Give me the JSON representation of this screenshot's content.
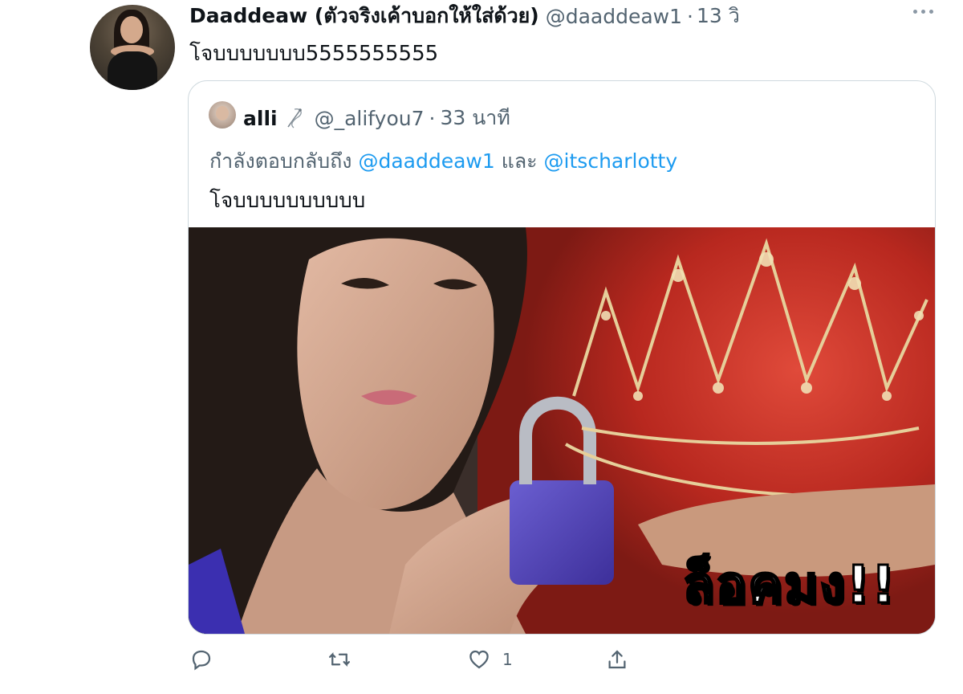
{
  "author": {
    "display_name": "Daaddeaw (ตัวจริงเค้าบอกให้ใส่ด้วย)",
    "handle": "@daaddeaw1",
    "separator": "·",
    "time": "13 วิ"
  },
  "tweet_text": "โจบบบบบบบ5555555555",
  "quoted": {
    "display_name": "alli",
    "handle": "@_alifyou7",
    "separator": "·",
    "time": "33 นาที",
    "reply_prefix": "กำลังตอบกลับถึง",
    "mention_1": "@daaddeaw1",
    "reply_and": "และ",
    "mention_2": "@itscharlotty",
    "text": "โจบบบบบบบบบบ",
    "image_caption": "ล็อคมง!!"
  },
  "actions": {
    "reply_icon": "reply-icon",
    "retweet_icon": "retweet-icon",
    "like_icon": "heart-icon",
    "like_count": "1",
    "share_icon": "share-icon"
  },
  "colors": {
    "link": "#1d9bf0",
    "secondary_text": "#536471",
    "border": "#cfd9de"
  }
}
